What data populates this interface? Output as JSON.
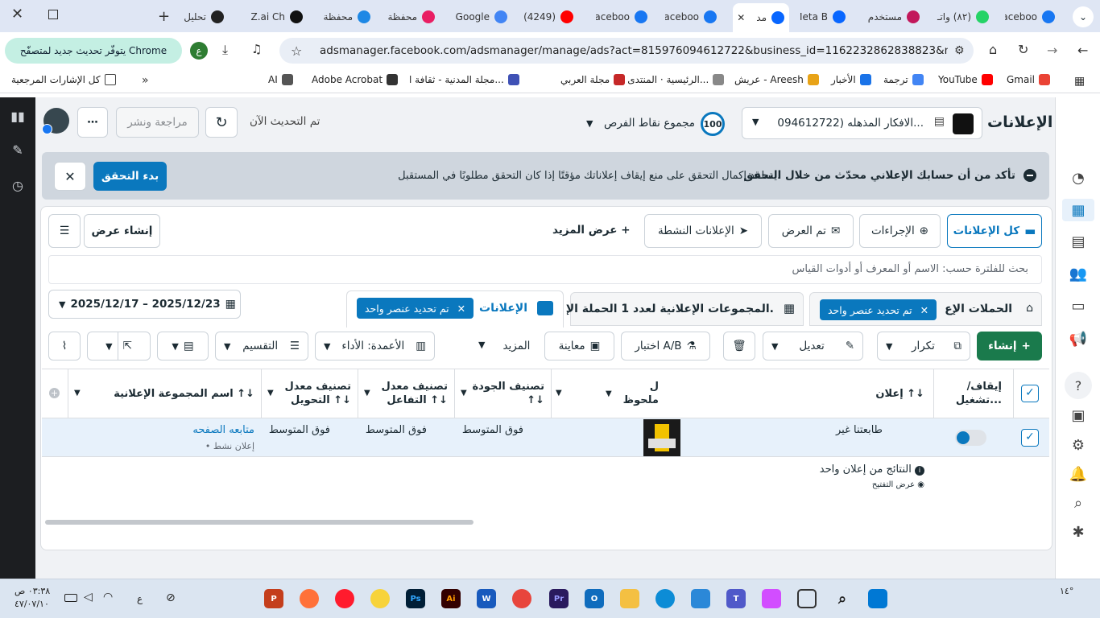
{
  "browser": {
    "tabs": [
      {
        "label": "Faceboo",
        "icon": "facebook-icon",
        "color": "#1877f2"
      },
      {
        "label": "(٨٢) واتـ",
        "icon": "whatsapp-icon",
        "color": "#25d366"
      },
      {
        "label": "مستخدم",
        "icon": "chart-icon",
        "color": "#c2185b"
      },
      {
        "label": "Meta B",
        "icon": "meta-icon",
        "color": "#0866ff"
      },
      {
        "label": "مد",
        "icon": "meta-icon",
        "color": "#0866ff",
        "active": true
      },
      {
        "label": "Faceboo",
        "icon": "facebook-icon",
        "color": "#1877f2"
      },
      {
        "label": "Faceboo",
        "icon": "facebook-icon",
        "color": "#1877f2"
      },
      {
        "label": "(4249)",
        "icon": "youtube-icon",
        "color": "#ff0000"
      },
      {
        "label": "Google",
        "icon": "gemini-icon",
        "color": "#4285f4"
      },
      {
        "label": "محفظة",
        "icon": "chart-icon",
        "color": "#e91e63"
      },
      {
        "label": "محفظة",
        "icon": "eye-icon",
        "color": "#1e88e5"
      },
      {
        "label": "Z.ai Ch",
        "icon": "z-icon",
        "color": "#111111"
      },
      {
        "label": "تحليل إ",
        "icon": "openai-icon",
        "color": "#222222"
      }
    ],
    "url": "adsmanager.facebook.com/adsmanager/manage/ads?act=815976094612722&business_id=1162232862838823&nav_entry_...",
    "update_label": "يتوفّر تحديث جديد لمتصفّح Chrome",
    "profile_initial": "ع",
    "bookmarks": [
      {
        "label": "Gmail",
        "color": "#ea4335"
      },
      {
        "label": "YouTube",
        "color": "#ff0000"
      },
      {
        "label": "ترجمة",
        "color": "#4285f4"
      },
      {
        "label": "الأخبار",
        "color": "#1a73e8"
      },
      {
        "label": "عريش - Areesh",
        "color": "#e8a317"
      },
      {
        "label": "الرئيسية · المنتدى الع...",
        "color": "#888888"
      },
      {
        "label": "مجلة العربي",
        "color": "#c62828"
      },
      {
        "label": "مجلة المدنية - ثقافة ا...",
        "color": "#3f51b5"
      },
      {
        "label": "Adobe Acrobat",
        "color": "#333333"
      },
      {
        "label": "AI",
        "color": "#555555"
      }
    ],
    "bookmarks_folder": "كل الإشارات المرجعية"
  },
  "header": {
    "title": "الإعلانات",
    "account": "الافكار المذهله (094612722...",
    "opportunity_score": "100",
    "opportunity_label": "مجموع نقاط الفرص",
    "updated": "تم التحديث الآن",
    "review_publish": "مراجعة ونشر"
  },
  "banner": {
    "title": "تأكد من أن حسابك الإعلاني محدّث من خلال التحقق",
    "body": "يساعد إكمال التحقق على منع إيقاف إعلاناتك مؤقتًا إذا كان التحقق مطلوبًا في المستقبل.",
    "cta": "بدء التحقق"
  },
  "filters": {
    "all_ads": "كل الإعلانات",
    "actions": "الإجراءات",
    "shown": "تم العرض",
    "active_ads": "الإعلانات النشطة",
    "more_views": "عرض المزيد",
    "create_view": "إنشاء عرض",
    "search_placeholder": "بحث للفلترة حسب: الاسم أو المعرف أو أدوات القياس"
  },
  "levels": {
    "campaigns": "الحملات الإع",
    "campaigns_chip": "تم تحديد عنصر واحد",
    "adsets": "المجموعات الإعلانية لعدد 1 الحملة الإ.",
    "ads": "الإعلانات",
    "ads_chip": "تم تحديد عنصر واحد",
    "date_range": "2025/12/17 – 2025/12/23"
  },
  "toolbar": {
    "create": "إنشاء",
    "duplicate": "تكرار",
    "edit": "تعديل",
    "ab_test": "اختبار A/B",
    "preview": "معاينة",
    "more": "المزيد",
    "columns": "الأعمدة: الأداء",
    "breakdown": "التقسيم"
  },
  "table": {
    "headers": {
      "toggle": "إيقاف/ تشغيل...",
      "ad": "إعلان ↑↓",
      "note": "ل ملحوظ",
      "quality": "تصنيف الجودة ↑↓",
      "engagement": "تصنيف معدل التفاعل ↑↓",
      "conversion": "تصنيف معدل التحويل ↑↓",
      "adset_name": "اسم المجموعة الإعلانية ↑↓"
    },
    "row": {
      "ad": "طابعتنا غير",
      "quality": "فوق المتوسط",
      "engagement": "فوق المتوسط",
      "conversion": "فوق المتوسط",
      "adset_name": "متابعه الصفحه",
      "adset_status": "• إعلان نشط"
    },
    "results_label": "النتائج من إعلان واحد",
    "results_sub": "عرض التفتيح"
  },
  "taskbar": {
    "time": "٠٣:٣٨ ص",
    "date": "٤٧/٠٧/١٠",
    "lang": "ع",
    "weather": "١٤°"
  }
}
